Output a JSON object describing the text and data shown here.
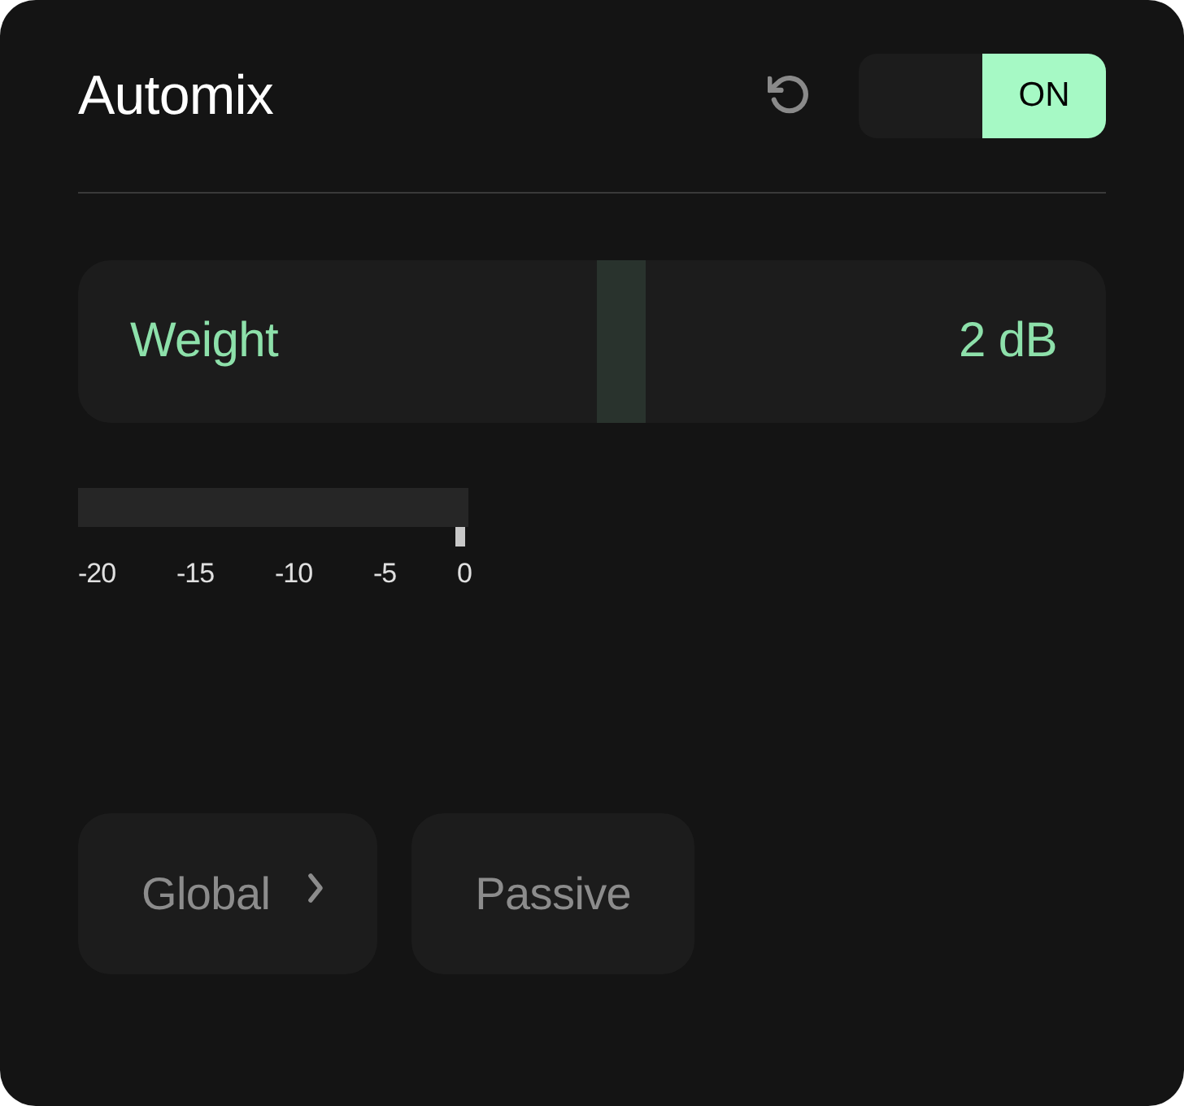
{
  "title": "Automix",
  "toggle": {
    "label": "ON",
    "on": true
  },
  "weight": {
    "label": "Weight",
    "value": "2 dB",
    "level": 0.53
  },
  "meter": {
    "level": 1,
    "ticks": [
      "-20",
      "-15",
      "-10",
      "-5",
      "0"
    ]
  },
  "buttons": [
    {
      "label": "Global",
      "kind": "menu"
    },
    {
      "label": "Passive",
      "kind": "plain"
    }
  ]
}
